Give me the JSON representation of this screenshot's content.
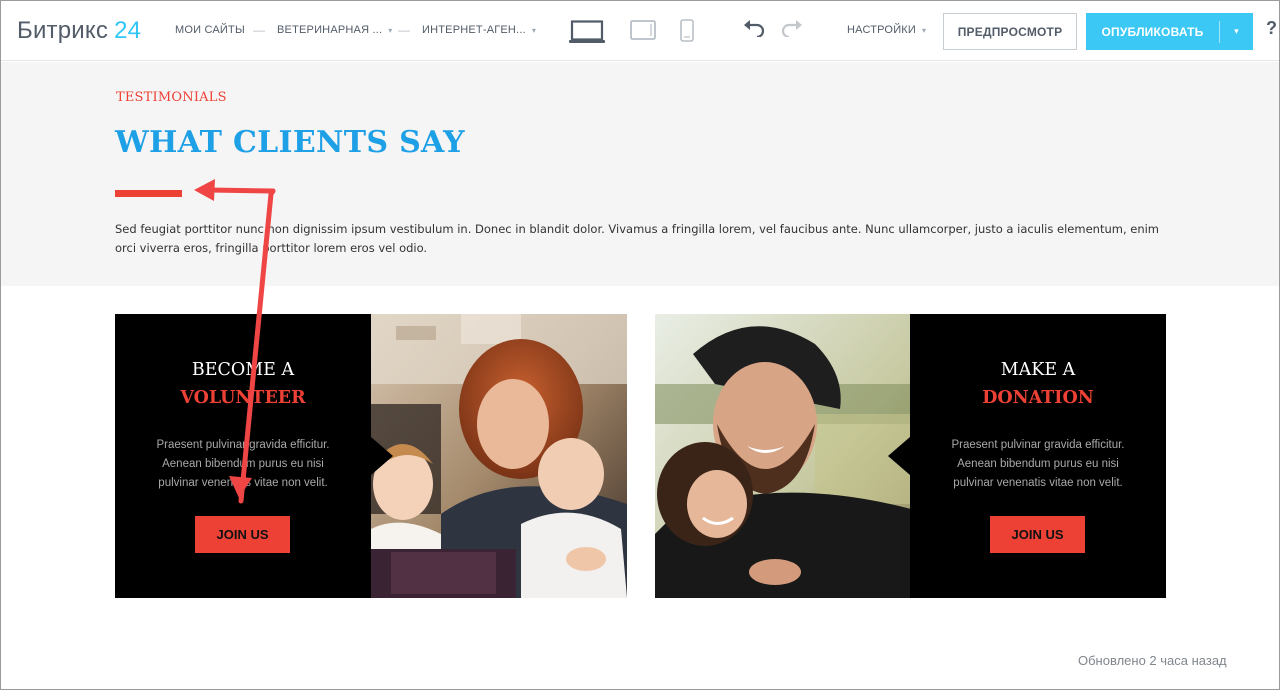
{
  "topbar": {
    "logo_text": "Битрикс",
    "logo_num": "24",
    "nav_my_sites": "МОИ САЙТЫ",
    "nav_site": "ВЕТЕРИНАРНАЯ ...",
    "nav_page": "ИНТЕРНЕТ-АГЕН...",
    "separator": "—",
    "caret": "▾",
    "settings": "НАСТРОЙКИ",
    "preview_button": "ПРЕДПРОСМОТР",
    "publish_button": "ОПУБЛИКОВАТЬ",
    "help": "?"
  },
  "hero": {
    "eyebrow": "TESTIMONIALS",
    "headline": "WHAT CLIENTS SAY",
    "paragraph": "Sed feugiat porttitor nunc non dignissim ipsum vestibulum in. Donec in blandit dolor. Vivamus a fringilla lorem, vel faucibus ante. Nunc ullamcorper, justo a iaculis elementum, enim orci viverra eros, fringilla porttitor lorem eros vel odio."
  },
  "cards": [
    {
      "title_line1": "BECOME A",
      "title_line2": "VOLUNTEER",
      "text": "Praesent pulvinar gravida efficitur. Aenean bibendum purus eu nisi pulvinar venenatis vitae non velit.",
      "button": "JOIN US"
    },
    {
      "title_line1": "MAKE A",
      "title_line2": "DONATION",
      "text": "Praesent pulvinar gravida efficitur. Aenean bibendum purus eu nisi pulvinar venenatis vitae non velit.",
      "button": "JOIN US"
    }
  ],
  "footer": {
    "updated": "Обновлено 2 часа назад"
  },
  "colors": {
    "accent_red": "#ee4136",
    "headline_blue": "#1ea0e6",
    "publish_blue": "#3bc8f5"
  },
  "icons": [
    "laptop-icon",
    "tablet-icon",
    "phone-icon",
    "undo-icon",
    "redo-icon",
    "dropdown-caret-icon",
    "help-icon"
  ]
}
